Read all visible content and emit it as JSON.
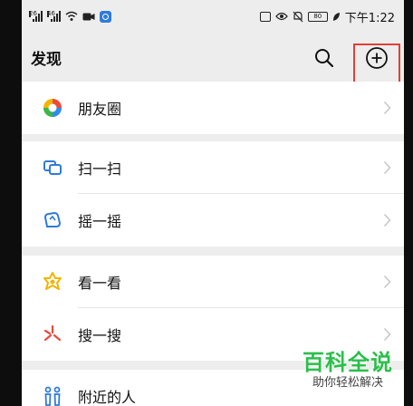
{
  "status_bar": {
    "sim1_tag": "26",
    "sim2_tag": "46",
    "battery_level": "80",
    "time": "下午1:22"
  },
  "header": {
    "title": "发现",
    "search_icon": "search-icon",
    "add_icon": "plus-circle-icon",
    "highlight_color": "#e0403a"
  },
  "groups": [
    {
      "items": [
        {
          "label": "朋友圈",
          "icon": "moments-icon"
        }
      ]
    },
    {
      "items": [
        {
          "label": "扫一扫",
          "icon": "scan-icon"
        },
        {
          "label": "摇一摇",
          "icon": "shake-icon"
        }
      ]
    },
    {
      "items": [
        {
          "label": "看一看",
          "icon": "top-stories-icon"
        },
        {
          "label": "搜一搜",
          "icon": "search-spark-icon"
        }
      ]
    },
    {
      "items": [
        {
          "label": "附近的人",
          "icon": "people-nearby-icon"
        }
      ]
    }
  ],
  "watermark": {
    "title": "百科全说",
    "subtitle": "助你轻松解决",
    "color": "#2bbf4a"
  }
}
